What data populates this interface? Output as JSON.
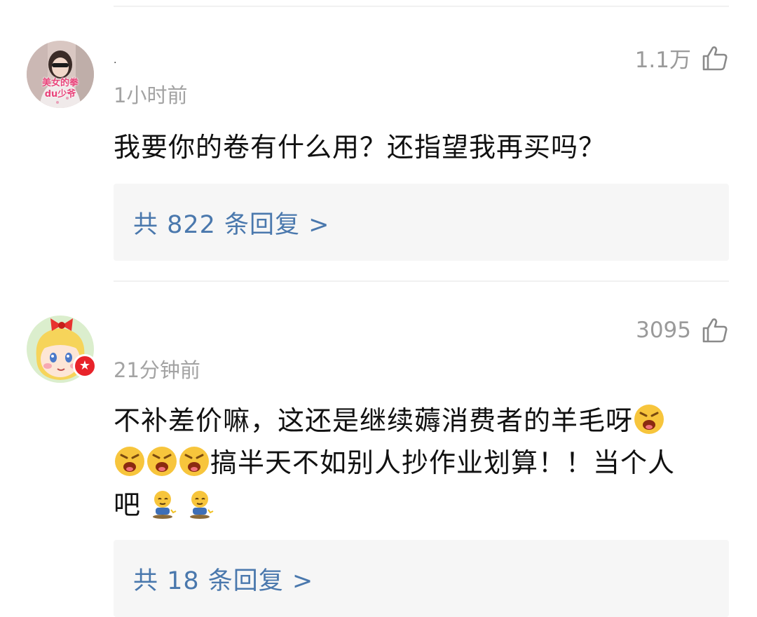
{
  "comments": [
    {
      "username": ".",
      "time": "1小时前",
      "likes": "1.1万",
      "text": "我要你的卷有什么用？还指望我再买吗？",
      "replies": "共 822 条回复 >",
      "avatar_caption": [
        "美女的拳",
        "du少爷"
      ]
    },
    {
      "username": "",
      "time": "21分钟前",
      "likes": "3095",
      "text_line1": "不补差价嘛，这还是继续薅消费者的羊毛呀",
      "text_line2": "搞半天不如别人抄作业划算！！当个人",
      "text_line3": "吧",
      "replies": "共 18 条回复 >",
      "badge": "★"
    }
  ],
  "icons": {
    "like": "thumbs-up-outline-icon",
    "emoji_angry": "angry-shouting-emoji",
    "emoji_sitting": "sitting-smirk-emoji"
  },
  "colors": {
    "reply_link": "#4a78ad",
    "muted": "#a3a3a3",
    "badge_red": "#e8232a"
  }
}
